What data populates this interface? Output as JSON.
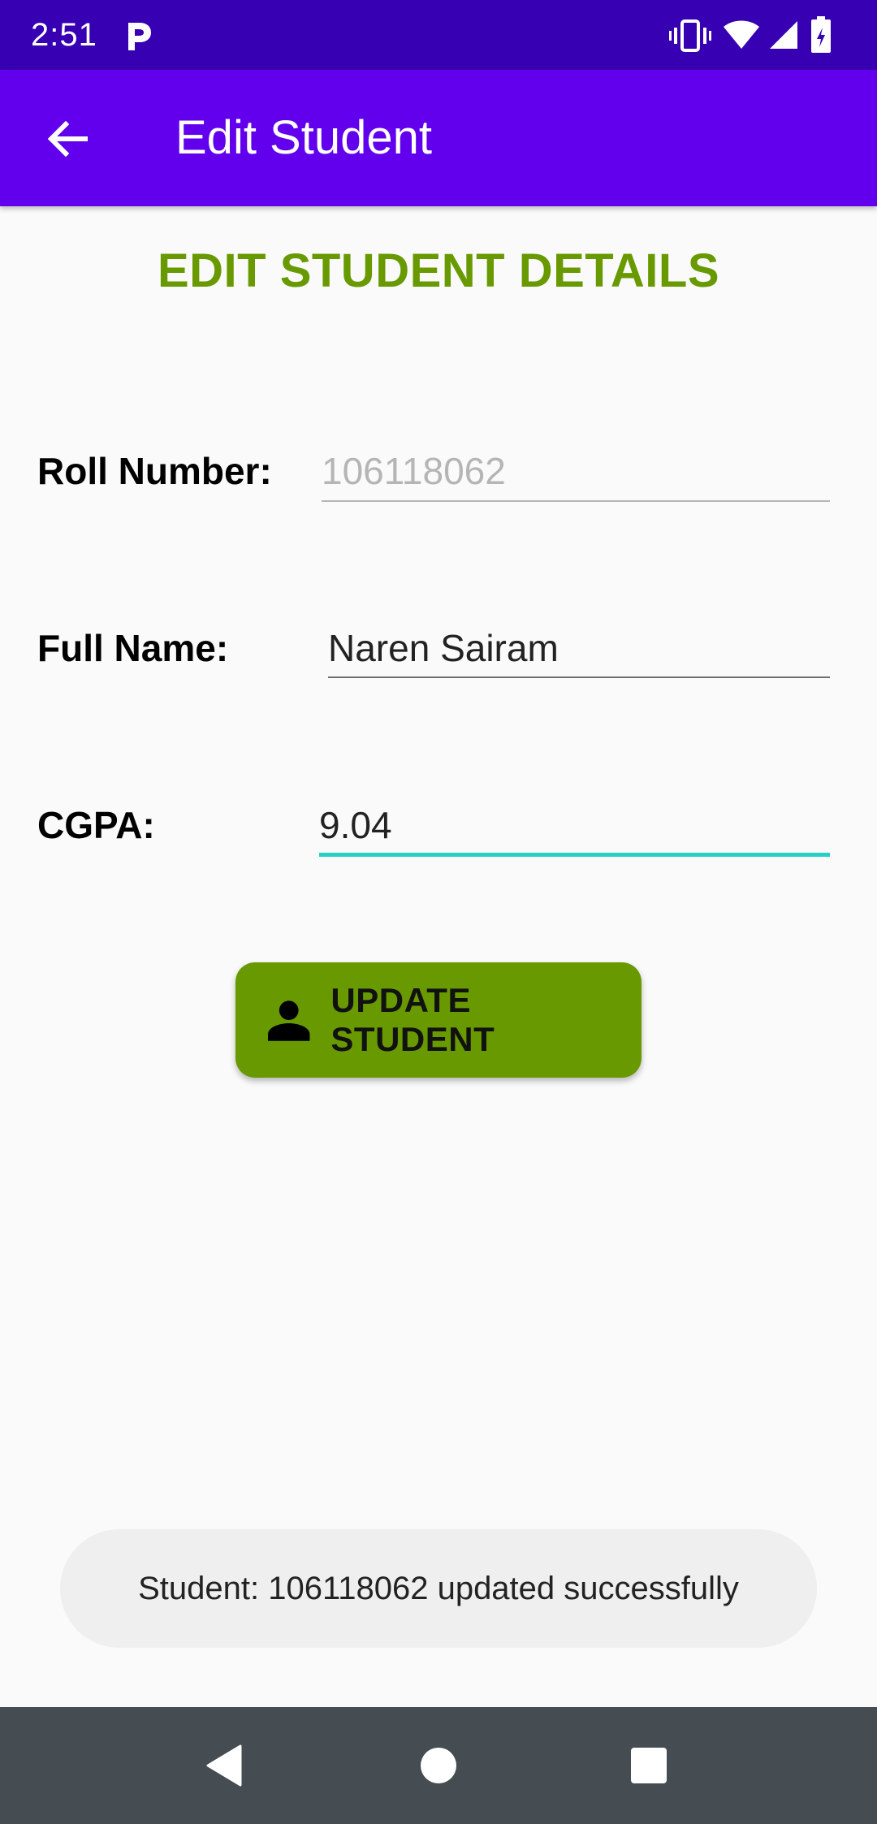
{
  "status_bar": {
    "time": "2:51",
    "icons": [
      "parking-icon",
      "vibrate-icon",
      "wifi-icon",
      "signal-icon",
      "battery-icon"
    ]
  },
  "app_bar": {
    "title": "Edit Student",
    "back_icon": "arrow-back-icon",
    "background": "#6200ee"
  },
  "form": {
    "heading": "EDIT STUDENT DETAILS",
    "heading_color": "#689a00",
    "roll_number": {
      "label": "Roll Number:",
      "value": "106118062",
      "enabled": false
    },
    "full_name": {
      "label": "Full Name:",
      "value": "Naren Sairam"
    },
    "cgpa": {
      "label": "CGPA:",
      "value": "9.04",
      "focused": true,
      "accent": "#26d0c3"
    },
    "update_button": {
      "label": "UPDATE STUDENT",
      "icon": "person-icon",
      "background": "#689a00"
    }
  },
  "toast": {
    "message": "Student: 106118062 updated successfully"
  },
  "nav_bar": {
    "buttons": [
      "back-triangle-icon",
      "home-circle-icon",
      "recents-square-icon"
    ]
  }
}
